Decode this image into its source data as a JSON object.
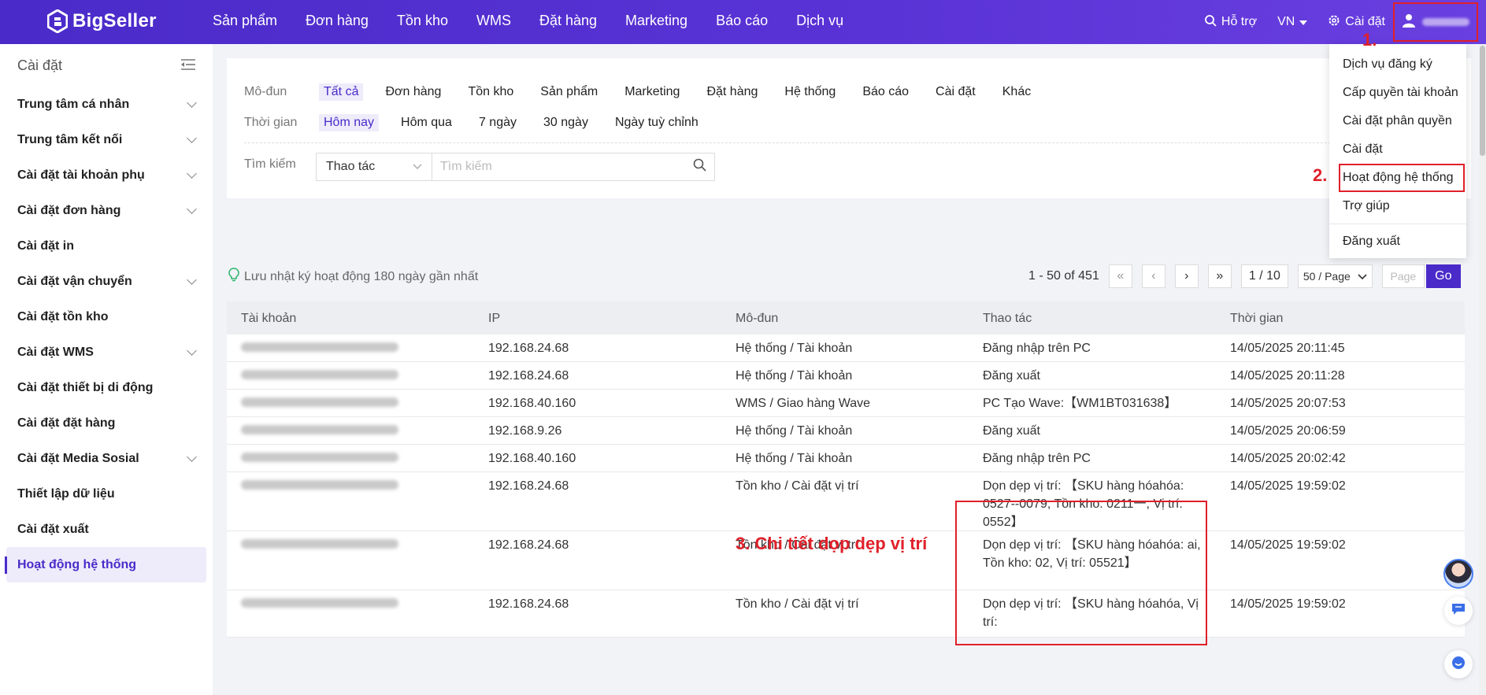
{
  "brand": {
    "name": "BigSeller"
  },
  "topnav": {
    "items": [
      "Sản phẩm",
      "Đơn hàng",
      "Tồn kho",
      "WMS",
      "Đặt hàng",
      "Marketing",
      "Báo cáo",
      "Dịch vụ"
    ],
    "support": "Hỗ trợ",
    "language": "VN",
    "settings": "Cài đặt"
  },
  "sidebar": {
    "title": "Cài đặt",
    "items": [
      {
        "label": "Trung tâm cá nhân",
        "expandable": true
      },
      {
        "label": "Trung tâm kết nối",
        "expandable": true
      },
      {
        "label": "Cài đặt tài khoản phụ",
        "expandable": true
      },
      {
        "label": "Cài đặt đơn hàng",
        "expandable": true
      },
      {
        "label": "Cài đặt in",
        "expandable": false
      },
      {
        "label": "Cài đặt vận chuyển",
        "expandable": true
      },
      {
        "label": "Cài đặt tồn kho",
        "expandable": false
      },
      {
        "label": "Cài đặt WMS",
        "expandable": true
      },
      {
        "label": "Cài đặt thiết bị di động",
        "expandable": false
      },
      {
        "label": "Cài đặt đặt hàng",
        "expandable": false
      },
      {
        "label": "Cài đặt Media Sosial",
        "expandable": true
      },
      {
        "label": "Thiết lập dữ liệu",
        "expandable": false
      },
      {
        "label": "Cài đặt xuất",
        "expandable": false
      },
      {
        "label": "Hoạt động hệ thống",
        "expandable": false,
        "active": true
      }
    ]
  },
  "filters": {
    "module_label": "Mô-đun",
    "modules": [
      "Tất cả",
      "Đơn hàng",
      "Tồn kho",
      "Sản phẩm",
      "Marketing",
      "Đặt hàng",
      "Hệ thống",
      "Báo cáo",
      "Cài đặt",
      "Khác"
    ],
    "time_label": "Thời gian",
    "times": [
      "Hôm nay",
      "Hôm qua",
      "7 ngày",
      "30 ngày",
      "Ngày tuỳ chỉnh"
    ],
    "search_label": "Tìm kiếm",
    "search_type": "Thao tác",
    "search_placeholder": "Tìm kiếm"
  },
  "info_text": "Lưu nhật ký hoạt động 180 ngày gần nhất",
  "pagination": {
    "range": "1 - 50 of 451",
    "page": "1 / 10",
    "per_page": "50 / Page",
    "page_placeholder": "Page",
    "go": "Go"
  },
  "table": {
    "headers": [
      "Tài khoản",
      "IP",
      "Mô-đun",
      "Thao tác",
      "Thời gian"
    ],
    "rows": [
      {
        "ip": "192.168.24.68",
        "module": "Hệ thống / Tài khoản",
        "op": "Đăng nhập trên PC",
        "time": "14/05/2025 20:11:45"
      },
      {
        "ip": "192.168.24.68",
        "module": "Hệ thống / Tài khoản",
        "op": "Đăng xuất",
        "time": "14/05/2025 20:11:28"
      },
      {
        "ip": "192.168.40.160",
        "module": "WMS / Giao hàng Wave",
        "op": "PC Tạo Wave:【WM1BT031638】",
        "time": "14/05/2025 20:07:53"
      },
      {
        "ip": "192.168.9.26",
        "module": "Hệ thống / Tài khoản",
        "op": "Đăng xuất",
        "time": "14/05/2025 20:06:59"
      },
      {
        "ip": "192.168.40.160",
        "module": "Hệ thống / Tài khoản",
        "op": "Đăng nhập trên PC",
        "time": "14/05/2025 20:02:42"
      },
      {
        "ip": "192.168.24.68",
        "module": "Tồn kho / Cài đặt vị trí",
        "op": "Dọn dẹp vị trí: 【SKU hàng hóahóa: 0527--0079, Tồn kho: 0211一, Vị trí: 0552】",
        "time": "14/05/2025 19:59:02"
      },
      {
        "ip": "192.168.24.68",
        "module": "Tồn kho / Cài đặt vị trí",
        "op": "Dọn dẹp vị trí: 【SKU hàng hóahóa: ai, Tồn kho: 02, Vị trí: 05521】",
        "time": "14/05/2025 19:59:02"
      },
      {
        "ip": "192.168.24.68",
        "module": "Tồn kho / Cài đặt vị trí",
        "op": "Dọn dẹp vị trí: 【SKU hàng hóahóa, Vị trí:",
        "time": "14/05/2025 19:59:02"
      }
    ]
  },
  "user_menu": {
    "items": [
      "Dịch vụ đăng ký",
      "Cấp quyền tài khoản",
      "Cài đặt phân quyền",
      "Cài đặt",
      "Hoạt động hệ thống",
      "Trợ giúp"
    ],
    "logout": "Đăng xuất"
  },
  "annotations": {
    "step1": "1.",
    "step2": "2.",
    "step3": "3. Chi tiết dọp dẹp vị trí"
  },
  "colors": {
    "primary": "#4a2bc9",
    "highlight": "#e0202a"
  }
}
